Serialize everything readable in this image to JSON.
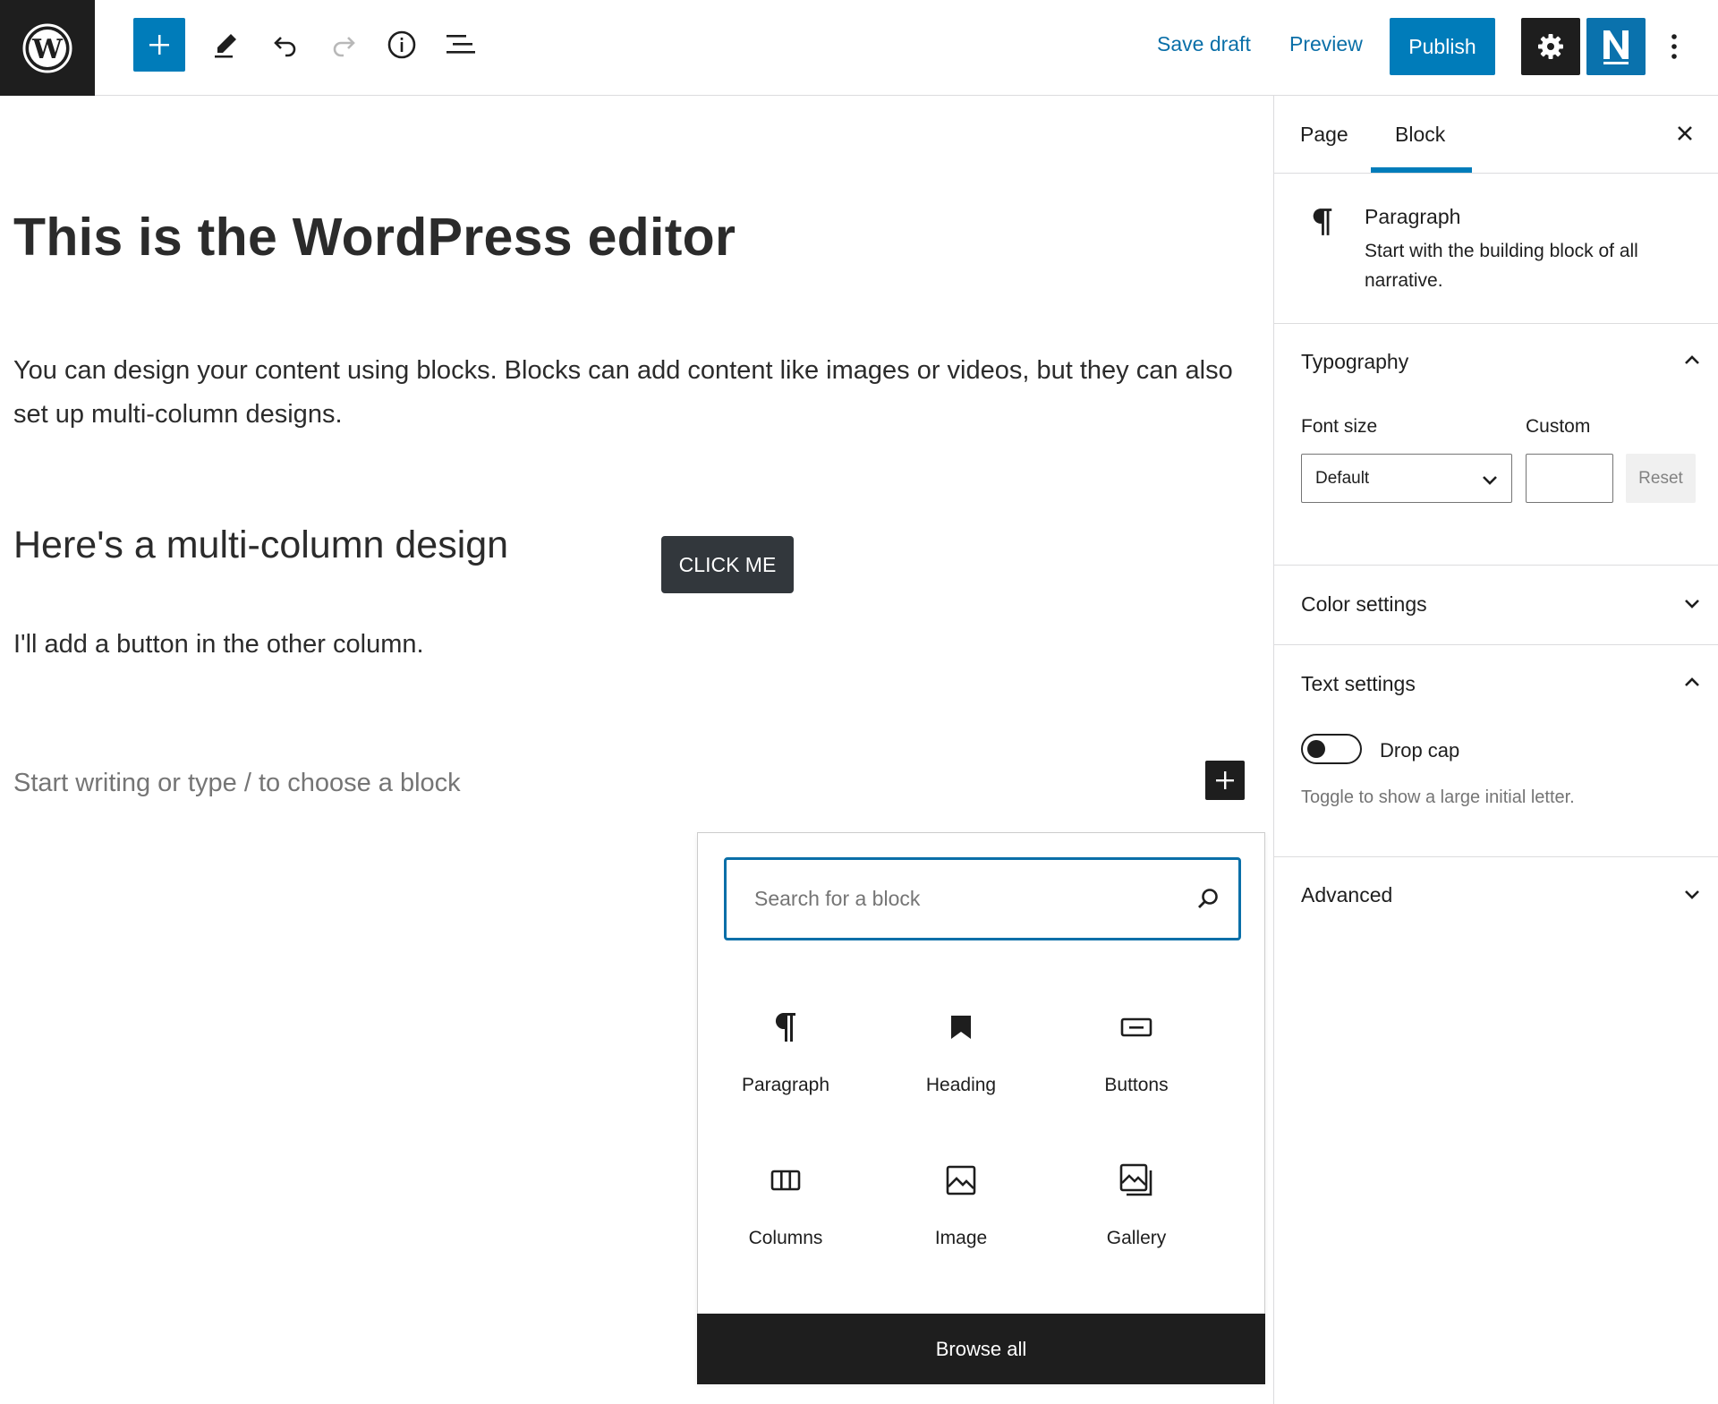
{
  "toolbar": {
    "save_draft": "Save draft",
    "preview": "Preview",
    "publish": "Publish",
    "accent_color": "#007cba",
    "icons": [
      "wordpress-logo-icon",
      "plus-icon",
      "pencil-icon",
      "undo-icon",
      "redo-icon",
      "info-icon",
      "list-view-icon",
      "gear-icon",
      "n-plugin-icon",
      "kebab-icon"
    ]
  },
  "editor": {
    "heading": "This is the WordPress editor",
    "paragraph": "You can design your content using blocks. Blocks can add content like images or videos, but they can also set up multi-column designs.",
    "subheading": "Here's a multi-column design",
    "button_label": "CLICK ME",
    "column_text": "I'll add a button in the other column.",
    "placeholder": "Start writing or type / to choose a block"
  },
  "inserter": {
    "search_placeholder": "Search for a block",
    "blocks": [
      {
        "label": "Paragraph",
        "icon": "paragraph-icon"
      },
      {
        "label": "Heading",
        "icon": "bookmark-icon"
      },
      {
        "label": "Buttons",
        "icon": "buttons-icon"
      },
      {
        "label": "Columns",
        "icon": "columns-icon"
      },
      {
        "label": "Image",
        "icon": "image-icon"
      },
      {
        "label": "Gallery",
        "icon": "gallery-icon"
      }
    ],
    "browse_all": "Browse all"
  },
  "sidebar": {
    "tabs": [
      {
        "label": "Page",
        "active": false
      },
      {
        "label": "Block",
        "active": true
      }
    ],
    "block_card": {
      "title": "Paragraph",
      "description": "Start with the building block of all narrative."
    },
    "typography": {
      "title": "Typography",
      "font_size_label": "Font size",
      "custom_label": "Custom",
      "font_size_value": "Default",
      "custom_value": "",
      "reset_label": "Reset"
    },
    "color_settings": {
      "title": "Color settings"
    },
    "text_settings": {
      "title": "Text settings",
      "drop_cap_label": "Drop cap",
      "drop_cap_enabled": false,
      "help": "Toggle to show a large initial letter."
    },
    "advanced": {
      "title": "Advanced"
    }
  }
}
